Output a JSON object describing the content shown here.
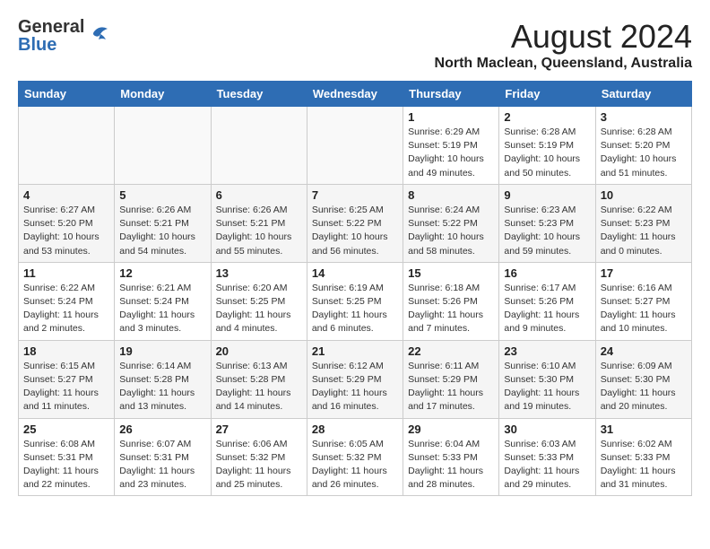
{
  "header": {
    "logo_general": "General",
    "logo_blue": "Blue",
    "month_year": "August 2024",
    "location": "North Maclean, Queensland, Australia"
  },
  "days_of_week": [
    "Sunday",
    "Monday",
    "Tuesday",
    "Wednesday",
    "Thursday",
    "Friday",
    "Saturday"
  ],
  "weeks": [
    {
      "row_class": "row-white",
      "days": [
        {
          "date": "",
          "empty": true
        },
        {
          "date": "",
          "empty": true
        },
        {
          "date": "",
          "empty": true
        },
        {
          "date": "",
          "empty": true
        },
        {
          "date": "1",
          "sunrise": "Sunrise: 6:29 AM",
          "sunset": "Sunset: 5:19 PM",
          "daylight": "Daylight: 10 hours and 49 minutes."
        },
        {
          "date": "2",
          "sunrise": "Sunrise: 6:28 AM",
          "sunset": "Sunset: 5:19 PM",
          "daylight": "Daylight: 10 hours and 50 minutes."
        },
        {
          "date": "3",
          "sunrise": "Sunrise: 6:28 AM",
          "sunset": "Sunset: 5:20 PM",
          "daylight": "Daylight: 10 hours and 51 minutes."
        }
      ]
    },
    {
      "row_class": "row-gray",
      "days": [
        {
          "date": "4",
          "sunrise": "Sunrise: 6:27 AM",
          "sunset": "Sunset: 5:20 PM",
          "daylight": "Daylight: 10 hours and 53 minutes."
        },
        {
          "date": "5",
          "sunrise": "Sunrise: 6:26 AM",
          "sunset": "Sunset: 5:21 PM",
          "daylight": "Daylight: 10 hours and 54 minutes."
        },
        {
          "date": "6",
          "sunrise": "Sunrise: 6:26 AM",
          "sunset": "Sunset: 5:21 PM",
          "daylight": "Daylight: 10 hours and 55 minutes."
        },
        {
          "date": "7",
          "sunrise": "Sunrise: 6:25 AM",
          "sunset": "Sunset: 5:22 PM",
          "daylight": "Daylight: 10 hours and 56 minutes."
        },
        {
          "date": "8",
          "sunrise": "Sunrise: 6:24 AM",
          "sunset": "Sunset: 5:22 PM",
          "daylight": "Daylight: 10 hours and 58 minutes."
        },
        {
          "date": "9",
          "sunrise": "Sunrise: 6:23 AM",
          "sunset": "Sunset: 5:23 PM",
          "daylight": "Daylight: 10 hours and 59 minutes."
        },
        {
          "date": "10",
          "sunrise": "Sunrise: 6:22 AM",
          "sunset": "Sunset: 5:23 PM",
          "daylight": "Daylight: 11 hours and 0 minutes."
        }
      ]
    },
    {
      "row_class": "row-white",
      "days": [
        {
          "date": "11",
          "sunrise": "Sunrise: 6:22 AM",
          "sunset": "Sunset: 5:24 PM",
          "daylight": "Daylight: 11 hours and 2 minutes."
        },
        {
          "date": "12",
          "sunrise": "Sunrise: 6:21 AM",
          "sunset": "Sunset: 5:24 PM",
          "daylight": "Daylight: 11 hours and 3 minutes."
        },
        {
          "date": "13",
          "sunrise": "Sunrise: 6:20 AM",
          "sunset": "Sunset: 5:25 PM",
          "daylight": "Daylight: 11 hours and 4 minutes."
        },
        {
          "date": "14",
          "sunrise": "Sunrise: 6:19 AM",
          "sunset": "Sunset: 5:25 PM",
          "daylight": "Daylight: 11 hours and 6 minutes."
        },
        {
          "date": "15",
          "sunrise": "Sunrise: 6:18 AM",
          "sunset": "Sunset: 5:26 PM",
          "daylight": "Daylight: 11 hours and 7 minutes."
        },
        {
          "date": "16",
          "sunrise": "Sunrise: 6:17 AM",
          "sunset": "Sunset: 5:26 PM",
          "daylight": "Daylight: 11 hours and 9 minutes."
        },
        {
          "date": "17",
          "sunrise": "Sunrise: 6:16 AM",
          "sunset": "Sunset: 5:27 PM",
          "daylight": "Daylight: 11 hours and 10 minutes."
        }
      ]
    },
    {
      "row_class": "row-gray",
      "days": [
        {
          "date": "18",
          "sunrise": "Sunrise: 6:15 AM",
          "sunset": "Sunset: 5:27 PM",
          "daylight": "Daylight: 11 hours and 11 minutes."
        },
        {
          "date": "19",
          "sunrise": "Sunrise: 6:14 AM",
          "sunset": "Sunset: 5:28 PM",
          "daylight": "Daylight: 11 hours and 13 minutes."
        },
        {
          "date": "20",
          "sunrise": "Sunrise: 6:13 AM",
          "sunset": "Sunset: 5:28 PM",
          "daylight": "Daylight: 11 hours and 14 minutes."
        },
        {
          "date": "21",
          "sunrise": "Sunrise: 6:12 AM",
          "sunset": "Sunset: 5:29 PM",
          "daylight": "Daylight: 11 hours and 16 minutes."
        },
        {
          "date": "22",
          "sunrise": "Sunrise: 6:11 AM",
          "sunset": "Sunset: 5:29 PM",
          "daylight": "Daylight: 11 hours and 17 minutes."
        },
        {
          "date": "23",
          "sunrise": "Sunrise: 6:10 AM",
          "sunset": "Sunset: 5:30 PM",
          "daylight": "Daylight: 11 hours and 19 minutes."
        },
        {
          "date": "24",
          "sunrise": "Sunrise: 6:09 AM",
          "sunset": "Sunset: 5:30 PM",
          "daylight": "Daylight: 11 hours and 20 minutes."
        }
      ]
    },
    {
      "row_class": "row-white",
      "days": [
        {
          "date": "25",
          "sunrise": "Sunrise: 6:08 AM",
          "sunset": "Sunset: 5:31 PM",
          "daylight": "Daylight: 11 hours and 22 minutes."
        },
        {
          "date": "26",
          "sunrise": "Sunrise: 6:07 AM",
          "sunset": "Sunset: 5:31 PM",
          "daylight": "Daylight: 11 hours and 23 minutes."
        },
        {
          "date": "27",
          "sunrise": "Sunrise: 6:06 AM",
          "sunset": "Sunset: 5:32 PM",
          "daylight": "Daylight: 11 hours and 25 minutes."
        },
        {
          "date": "28",
          "sunrise": "Sunrise: 6:05 AM",
          "sunset": "Sunset: 5:32 PM",
          "daylight": "Daylight: 11 hours and 26 minutes."
        },
        {
          "date": "29",
          "sunrise": "Sunrise: 6:04 AM",
          "sunset": "Sunset: 5:33 PM",
          "daylight": "Daylight: 11 hours and 28 minutes."
        },
        {
          "date": "30",
          "sunrise": "Sunrise: 6:03 AM",
          "sunset": "Sunset: 5:33 PM",
          "daylight": "Daylight: 11 hours and 29 minutes."
        },
        {
          "date": "31",
          "sunrise": "Sunrise: 6:02 AM",
          "sunset": "Sunset: 5:33 PM",
          "daylight": "Daylight: 11 hours and 31 minutes."
        }
      ]
    }
  ]
}
